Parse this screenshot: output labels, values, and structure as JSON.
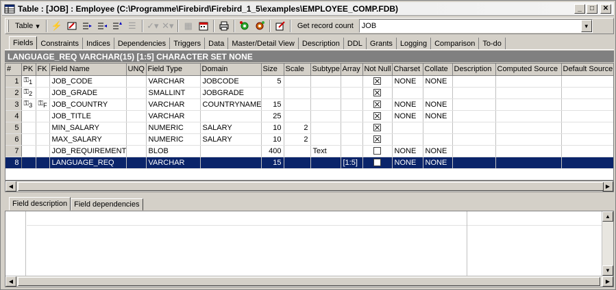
{
  "window": {
    "title": "Table : [JOB] : Employee (C:\\Programme\\Firebird\\Firebird_1_5\\examples\\EMPLOYEE_COMP.FDB)",
    "btn_min": "_",
    "btn_max": "□",
    "btn_close": "✕"
  },
  "toolbar": {
    "table_label": "Table",
    "get_record_count_label": "Get record count",
    "table_combo_value": "JOB"
  },
  "tabs": [
    "Fields",
    "Constraints",
    "Indices",
    "Dependencies",
    "Triggers",
    "Data",
    "Master/Detail View",
    "Description",
    "DDL",
    "Grants",
    "Logging",
    "Comparison",
    "To-do"
  ],
  "field_header": "LANGUAGE_REQ VARCHAR(15) [1:5] CHARACTER SET NONE",
  "grid": {
    "columns": [
      "#",
      "PK",
      "FK",
      "Field Name",
      "UNQ",
      "Field Type",
      "Domain",
      "Size",
      "Scale",
      "Subtype",
      "Array",
      "Not Null",
      "Charset",
      "Collate",
      "Description",
      "Computed Source",
      "Default Source"
    ],
    "rows": [
      {
        "n": "1",
        "pk": "1",
        "fk": "",
        "name": "JOB_CODE",
        "unq": "",
        "type": "VARCHAR",
        "domain": "JOBCODE",
        "size": "5",
        "scale": "",
        "subtype": "",
        "array": "",
        "notnull": true,
        "charset": "NONE",
        "collate": "NONE",
        "selected": false
      },
      {
        "n": "2",
        "pk": "2",
        "fk": "",
        "name": "JOB_GRADE",
        "unq": "",
        "type": "SMALLINT",
        "domain": "JOBGRADE",
        "size": "",
        "scale": "",
        "subtype": "",
        "array": "",
        "notnull": true,
        "charset": "",
        "collate": "",
        "selected": false
      },
      {
        "n": "3",
        "pk": "3",
        "fk": "F",
        "name": "JOB_COUNTRY",
        "unq": "",
        "type": "VARCHAR",
        "domain": "COUNTRYNAME",
        "size": "15",
        "scale": "",
        "subtype": "",
        "array": "",
        "notnull": true,
        "charset": "NONE",
        "collate": "NONE",
        "selected": false
      },
      {
        "n": "4",
        "pk": "",
        "fk": "",
        "name": "JOB_TITLE",
        "unq": "",
        "type": "VARCHAR",
        "domain": "",
        "size": "25",
        "scale": "",
        "subtype": "",
        "array": "",
        "notnull": true,
        "charset": "NONE",
        "collate": "NONE",
        "selected": false
      },
      {
        "n": "5",
        "pk": "",
        "fk": "",
        "name": "MIN_SALARY",
        "unq": "",
        "type": "NUMERIC",
        "domain": "SALARY",
        "size": "10",
        "scale": "2",
        "subtype": "",
        "array": "",
        "notnull": true,
        "charset": "",
        "collate": "",
        "selected": false
      },
      {
        "n": "6",
        "pk": "",
        "fk": "",
        "name": "MAX_SALARY",
        "unq": "",
        "type": "NUMERIC",
        "domain": "SALARY",
        "size": "10",
        "scale": "2",
        "subtype": "",
        "array": "",
        "notnull": true,
        "charset": "",
        "collate": "",
        "selected": false
      },
      {
        "n": "7",
        "pk": "",
        "fk": "",
        "name": "JOB_REQUIREMENT",
        "unq": "",
        "type": "BLOB",
        "domain": "",
        "size": "400",
        "scale": "",
        "subtype": "Text",
        "array": "",
        "notnull": false,
        "charset": "NONE",
        "collate": "NONE",
        "selected": false
      },
      {
        "n": "8",
        "pk": "",
        "fk": "",
        "name": "LANGUAGE_REQ",
        "unq": "",
        "type": "VARCHAR",
        "domain": "",
        "size": "15",
        "scale": "",
        "subtype": "",
        "array": "[1:5]",
        "notnull": false,
        "charset": "NONE",
        "collate": "NONE",
        "selected": true
      }
    ]
  },
  "bottom_tabs": [
    "Field description",
    "Field dependencies"
  ],
  "colors": {
    "selection": "#0a246a",
    "header_strip": "#808080",
    "face": "#d4d0c8"
  }
}
